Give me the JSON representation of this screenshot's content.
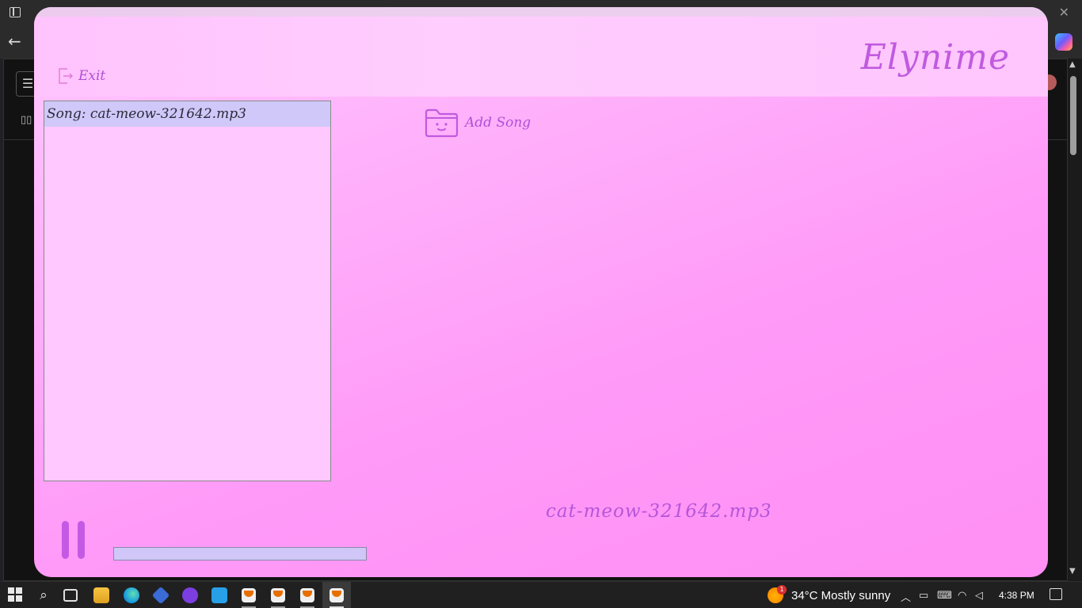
{
  "app": {
    "title": "Elynime",
    "exit_label": "Exit",
    "add_song_label": "Add Song",
    "playlist": [
      {
        "label": "Song: cat-meow-321642.mp3"
      }
    ],
    "now_playing": "cat-meow-321642.mp3",
    "playback_state": "playing",
    "progress": 0.0
  },
  "taskbar": {
    "weather_badge": "1",
    "weather": "34°C  Mostly sunny",
    "clock": "4:38 PM"
  },
  "colors": {
    "accent": "#c05ae0",
    "list_bg": "#ffc9ff",
    "selected_item": "#cfc8f8",
    "progress_track": "#d0c6f7",
    "window_gradient_start": "#ffc9ff",
    "window_gradient_end": "#ff8ff4"
  },
  "icons": {
    "exit": "exit-door-icon",
    "add_song": "folder-face-icon",
    "pause": "pause-icon"
  }
}
